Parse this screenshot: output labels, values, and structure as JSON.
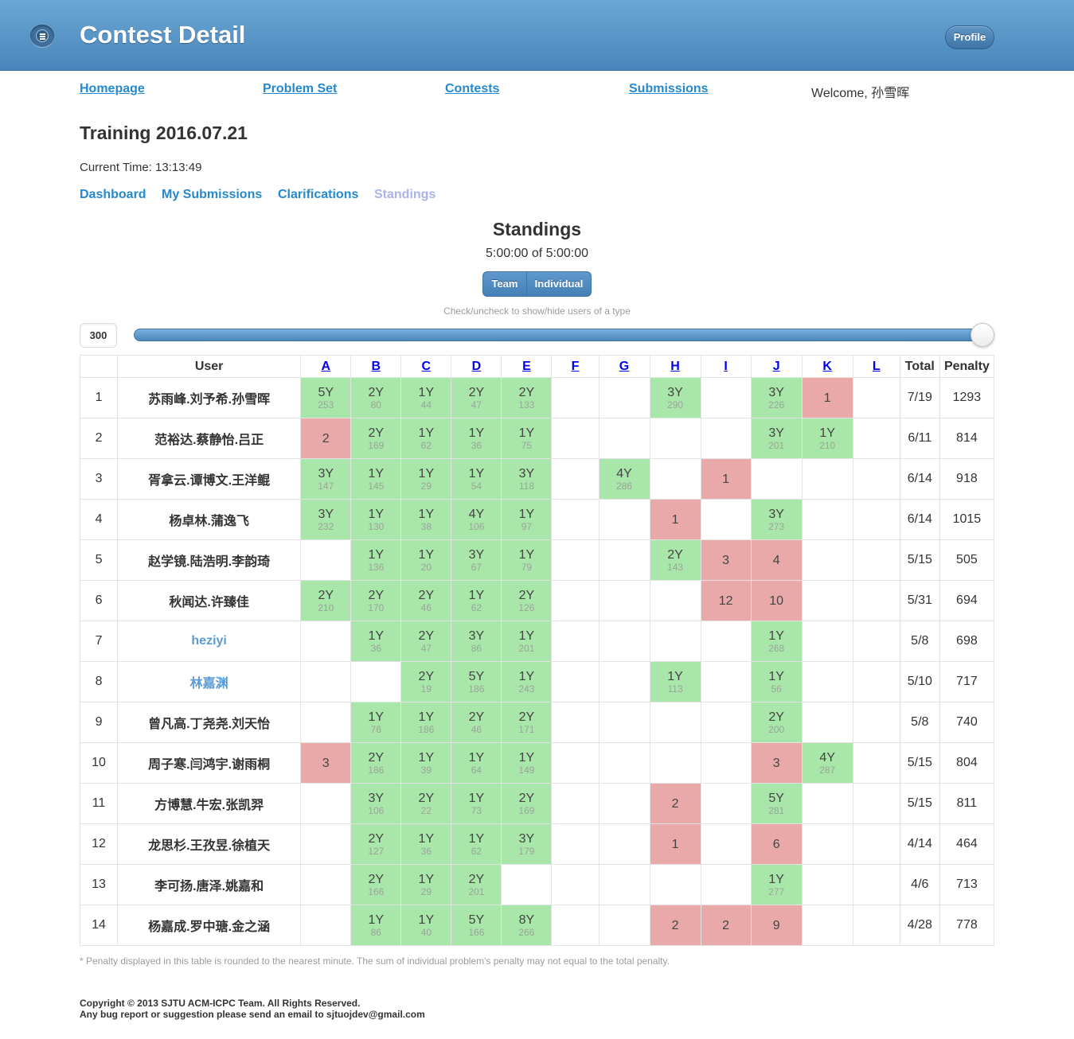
{
  "header": {
    "title": "Contest Detail",
    "profile_label": "Profile"
  },
  "nav": {
    "homepage": "Homepage",
    "problem_set": "Problem Set",
    "contests": "Contests",
    "submissions": "Submissions",
    "welcome": "Welcome, 孙雪晖"
  },
  "contest": {
    "name": "Training 2016.07.21",
    "current_time": "Current Time: 13:13:49"
  },
  "subnav": {
    "dashboard": "Dashboard",
    "my_submissions": "My Submissions",
    "clarifications": "Clarifications",
    "standings": "Standings"
  },
  "standings": {
    "title": "Standings",
    "time": "5:00:00 of 5:00:00",
    "toggle_team": "Team",
    "toggle_individual": "Individual",
    "hint": "Check/uncheck to show/hide users of a type",
    "slider_value": "300",
    "header_user": "User",
    "header_total": "Total",
    "header_penalty": "Penalty",
    "problems": [
      "A",
      "B",
      "C",
      "D",
      "E",
      "F",
      "G",
      "H",
      "I",
      "J",
      "K",
      "L"
    ],
    "rows": [
      {
        "rank": "1",
        "user": "苏雨峰.刘予希.孙雪晖",
        "type": "team",
        "cells": [
          [
            "ac",
            "5Y",
            "253"
          ],
          [
            "ac",
            "2Y",
            "80"
          ],
          [
            "ac",
            "1Y",
            "44"
          ],
          [
            "ac",
            "2Y",
            "47"
          ],
          [
            "ac",
            "2Y",
            "133"
          ],
          [
            "",
            "",
            ""
          ],
          [
            "",
            "",
            ""
          ],
          [
            "ac",
            "3Y",
            "290"
          ],
          [
            "",
            "",
            ""
          ],
          [
            "ac",
            "3Y",
            "226"
          ],
          [
            "wa",
            "1",
            ""
          ],
          [
            "",
            "",
            ""
          ]
        ],
        "total": "7/19",
        "penalty": "1293"
      },
      {
        "rank": "2",
        "user": "范裕达.蔡静怡.吕正",
        "type": "team",
        "cells": [
          [
            "wa",
            "2",
            ""
          ],
          [
            "ac",
            "2Y",
            "169"
          ],
          [
            "ac",
            "1Y",
            "62"
          ],
          [
            "ac",
            "1Y",
            "36"
          ],
          [
            "ac",
            "1Y",
            "75"
          ],
          [
            "",
            "",
            ""
          ],
          [
            "",
            "",
            ""
          ],
          [
            "",
            "",
            ""
          ],
          [
            "",
            "",
            ""
          ],
          [
            "ac",
            "3Y",
            "201"
          ],
          [
            "ac",
            "1Y",
            "210"
          ],
          [
            "",
            "",
            ""
          ]
        ],
        "total": "6/11",
        "penalty": "814"
      },
      {
        "rank": "3",
        "user": "胥拿云.谭博文.王洋鲲",
        "type": "team",
        "cells": [
          [
            "ac",
            "3Y",
            "147"
          ],
          [
            "ac",
            "1Y",
            "145"
          ],
          [
            "ac",
            "1Y",
            "29"
          ],
          [
            "ac",
            "1Y",
            "54"
          ],
          [
            "ac",
            "3Y",
            "118"
          ],
          [
            "",
            "",
            ""
          ],
          [
            "ac",
            "4Y",
            "286"
          ],
          [
            "",
            "",
            ""
          ],
          [
            "wa",
            "1",
            ""
          ],
          [
            "",
            "",
            ""
          ],
          [
            "",
            "",
            ""
          ],
          [
            "",
            "",
            ""
          ]
        ],
        "total": "6/14",
        "penalty": "918"
      },
      {
        "rank": "4",
        "user": "杨卓林.蒲逸飞",
        "type": "team",
        "cells": [
          [
            "ac",
            "3Y",
            "232"
          ],
          [
            "ac",
            "1Y",
            "130"
          ],
          [
            "ac",
            "1Y",
            "38"
          ],
          [
            "ac",
            "4Y",
            "106"
          ],
          [
            "ac",
            "1Y",
            "97"
          ],
          [
            "",
            "",
            ""
          ],
          [
            "",
            "",
            ""
          ],
          [
            "wa",
            "1",
            ""
          ],
          [
            "",
            "",
            ""
          ],
          [
            "ac",
            "3Y",
            "273"
          ],
          [
            "",
            "",
            ""
          ],
          [
            "",
            "",
            ""
          ]
        ],
        "total": "6/14",
        "penalty": "1015"
      },
      {
        "rank": "5",
        "user": "赵学镜.陆浩明.李韵琦",
        "type": "team",
        "cells": [
          [
            "",
            "",
            ""
          ],
          [
            "ac",
            "1Y",
            "136"
          ],
          [
            "ac",
            "1Y",
            "20"
          ],
          [
            "ac",
            "3Y",
            "67"
          ],
          [
            "ac",
            "1Y",
            "79"
          ],
          [
            "",
            "",
            ""
          ],
          [
            "",
            "",
            ""
          ],
          [
            "ac",
            "2Y",
            "143"
          ],
          [
            "wa",
            "3",
            ""
          ],
          [
            "wa",
            "4",
            ""
          ],
          [
            "",
            "",
            ""
          ],
          [
            "",
            "",
            ""
          ]
        ],
        "total": "5/15",
        "penalty": "505"
      },
      {
        "rank": "6",
        "user": "秋闻达.许臻佳",
        "type": "team",
        "cells": [
          [
            "ac",
            "2Y",
            "210"
          ],
          [
            "ac",
            "2Y",
            "170"
          ],
          [
            "ac",
            "2Y",
            "46"
          ],
          [
            "ac",
            "1Y",
            "62"
          ],
          [
            "ac",
            "2Y",
            "126"
          ],
          [
            "",
            "",
            ""
          ],
          [
            "",
            "",
            ""
          ],
          [
            "",
            "",
            ""
          ],
          [
            "wa",
            "12",
            ""
          ],
          [
            "wa",
            "10",
            ""
          ],
          [
            "",
            "",
            ""
          ],
          [
            "",
            "",
            ""
          ]
        ],
        "total": "5/31",
        "penalty": "694"
      },
      {
        "rank": "7",
        "user": "heziyi",
        "type": "individual",
        "cells": [
          [
            "",
            "",
            ""
          ],
          [
            "ac",
            "1Y",
            "36"
          ],
          [
            "ac",
            "2Y",
            "47"
          ],
          [
            "ac",
            "3Y",
            "86"
          ],
          [
            "ac",
            "1Y",
            "201"
          ],
          [
            "",
            "",
            ""
          ],
          [
            "",
            "",
            ""
          ],
          [
            "",
            "",
            ""
          ],
          [
            "",
            "",
            ""
          ],
          [
            "ac",
            "1Y",
            "268"
          ],
          [
            "",
            "",
            ""
          ],
          [
            "",
            "",
            ""
          ]
        ],
        "total": "5/8",
        "penalty": "698"
      },
      {
        "rank": "8",
        "user": "林嘉渊",
        "type": "individual",
        "cells": [
          [
            "",
            "",
            ""
          ],
          [
            "",
            "",
            ""
          ],
          [
            "ac",
            "2Y",
            "19"
          ],
          [
            "ac",
            "5Y",
            "186"
          ],
          [
            "ac",
            "1Y",
            "243"
          ],
          [
            "",
            "",
            ""
          ],
          [
            "",
            "",
            ""
          ],
          [
            "ac",
            "1Y",
            "113"
          ],
          [
            "",
            "",
            ""
          ],
          [
            "ac",
            "1Y",
            "56"
          ],
          [
            "",
            "",
            ""
          ],
          [
            "",
            "",
            ""
          ]
        ],
        "total": "5/10",
        "penalty": "717"
      },
      {
        "rank": "9",
        "user": "曾凡高.丁尧尧.刘天怡",
        "type": "team",
        "cells": [
          [
            "",
            "",
            ""
          ],
          [
            "ac",
            "1Y",
            "76"
          ],
          [
            "ac",
            "1Y",
            "186"
          ],
          [
            "ac",
            "2Y",
            "46"
          ],
          [
            "ac",
            "2Y",
            "171"
          ],
          [
            "",
            "",
            ""
          ],
          [
            "",
            "",
            ""
          ],
          [
            "",
            "",
            ""
          ],
          [
            "",
            "",
            ""
          ],
          [
            "ac",
            "2Y",
            "200"
          ],
          [
            "",
            "",
            ""
          ],
          [
            "",
            "",
            ""
          ]
        ],
        "total": "5/8",
        "penalty": "740"
      },
      {
        "rank": "10",
        "user": "周子寒.闫鸿宇.谢雨桐",
        "type": "team",
        "cells": [
          [
            "wa",
            "3",
            ""
          ],
          [
            "ac",
            "2Y",
            "186"
          ],
          [
            "ac",
            "1Y",
            "39"
          ],
          [
            "ac",
            "1Y",
            "64"
          ],
          [
            "ac",
            "1Y",
            "149"
          ],
          [
            "",
            "",
            ""
          ],
          [
            "",
            "",
            ""
          ],
          [
            "",
            "",
            ""
          ],
          [
            "",
            "",
            ""
          ],
          [
            "wa",
            "3",
            ""
          ],
          [
            "ac",
            "4Y",
            "287"
          ],
          [
            "",
            "",
            ""
          ]
        ],
        "total": "5/15",
        "penalty": "804"
      },
      {
        "rank": "11",
        "user": "方博慧.牛宏.张凯羿",
        "type": "team",
        "cells": [
          [
            "",
            "",
            ""
          ],
          [
            "ac",
            "3Y",
            "106"
          ],
          [
            "ac",
            "2Y",
            "22"
          ],
          [
            "ac",
            "1Y",
            "73"
          ],
          [
            "ac",
            "2Y",
            "169"
          ],
          [
            "",
            "",
            ""
          ],
          [
            "",
            "",
            ""
          ],
          [
            "wa",
            "2",
            ""
          ],
          [
            "",
            "",
            ""
          ],
          [
            "ac",
            "5Y",
            "281"
          ],
          [
            "",
            "",
            ""
          ],
          [
            "",
            "",
            ""
          ]
        ],
        "total": "5/15",
        "penalty": "811"
      },
      {
        "rank": "12",
        "user": "龙思杉.王孜昱.徐植天",
        "type": "team",
        "cells": [
          [
            "",
            "",
            ""
          ],
          [
            "ac",
            "2Y",
            "127"
          ],
          [
            "ac",
            "1Y",
            "36"
          ],
          [
            "ac",
            "1Y",
            "62"
          ],
          [
            "ac",
            "3Y",
            "179"
          ],
          [
            "",
            "",
            ""
          ],
          [
            "",
            "",
            ""
          ],
          [
            "wa",
            "1",
            ""
          ],
          [
            "",
            "",
            ""
          ],
          [
            "wa",
            "6",
            ""
          ],
          [
            "",
            "",
            ""
          ],
          [
            "",
            "",
            ""
          ]
        ],
        "total": "4/14",
        "penalty": "464"
      },
      {
        "rank": "13",
        "user": "李可扬.唐泽.姚嘉和",
        "type": "team",
        "cells": [
          [
            "",
            "",
            ""
          ],
          [
            "ac",
            "2Y",
            "166"
          ],
          [
            "ac",
            "1Y",
            "29"
          ],
          [
            "ac",
            "2Y",
            "201"
          ],
          [
            "",
            "",
            ""
          ],
          [
            "",
            "",
            ""
          ],
          [
            "",
            "",
            ""
          ],
          [
            "",
            "",
            ""
          ],
          [
            "",
            "",
            ""
          ],
          [
            "ac",
            "1Y",
            "277"
          ],
          [
            "",
            "",
            ""
          ],
          [
            "",
            "",
            ""
          ]
        ],
        "total": "4/6",
        "penalty": "713"
      },
      {
        "rank": "14",
        "user": "杨嘉成.罗中瑭.金之涵",
        "type": "team",
        "cells": [
          [
            "",
            "",
            ""
          ],
          [
            "ac",
            "1Y",
            "86"
          ],
          [
            "ac",
            "1Y",
            "40"
          ],
          [
            "ac",
            "5Y",
            "166"
          ],
          [
            "ac",
            "8Y",
            "266"
          ],
          [
            "",
            "",
            ""
          ],
          [
            "",
            "",
            ""
          ],
          [
            "wa",
            "2",
            ""
          ],
          [
            "wa",
            "2",
            ""
          ],
          [
            "wa",
            "9",
            ""
          ],
          [
            "",
            "",
            ""
          ],
          [
            "",
            "",
            ""
          ]
        ],
        "total": "4/28",
        "penalty": "778"
      }
    ]
  },
  "footer": {
    "footnote": "* Penalty displayed in this table is rounded to the nearest minute. The sum of individual problem's penalty may not equal to the total penalty.",
    "copyright": "Copyright © 2013 SJTU ACM-ICPC Team. All Rights Reserved.",
    "bug_report": "Any bug report or suggestion please send an email to sjtuojdev@gmail.com"
  }
}
